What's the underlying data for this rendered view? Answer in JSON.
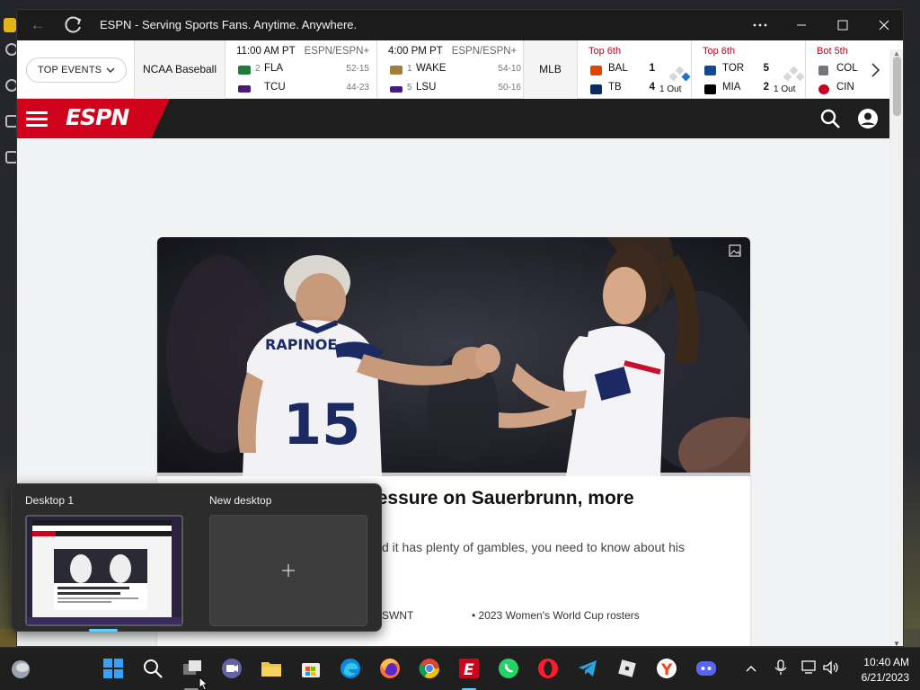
{
  "window": {
    "title": "ESPN - Serving Sports Fans. Anytime. Anywhere."
  },
  "scores_bar": {
    "top_events_label": "TOP EVENTS",
    "ncaa_label": "NCAA Baseball",
    "mlb_label": "MLB",
    "ncaa_games": [
      {
        "time": "11:00 AM PT",
        "network": "ESPN/ESPN+",
        "teams": [
          {
            "rank": "2",
            "abbr": "FLA",
            "record": "52-15"
          },
          {
            "rank": "",
            "abbr": "TCU",
            "record": "44-23"
          }
        ]
      },
      {
        "time": "4:00 PM PT",
        "network": "ESPN/ESPN+",
        "teams": [
          {
            "rank": "1",
            "abbr": "WAKE",
            "record": "54-10"
          },
          {
            "rank": "5",
            "abbr": "LSU",
            "record": "50-16"
          }
        ]
      }
    ],
    "mlb_games": [
      {
        "inning": "Top 6th",
        "teams": [
          {
            "abbr": "BAL",
            "score": "1"
          },
          {
            "abbr": "TB",
            "score": "4"
          }
        ],
        "outs": "1 Out"
      },
      {
        "inning": "Top 6th",
        "teams": [
          {
            "abbr": "TOR",
            "score": "5"
          },
          {
            "abbr": "MIA",
            "score": "2"
          }
        ],
        "outs": "1 Out"
      },
      {
        "inning": "Bot 5th",
        "teams": [
          {
            "abbr": "COL",
            "score": ""
          },
          {
            "abbr": "CIN",
            "score": ""
          }
        ],
        "outs": ""
      }
    ]
  },
  "header": {
    "logo_text": "ESPN",
    "accent_color": "#d0021b"
  },
  "story": {
    "title": "Cup roster reaction: Pressure on Sauerbrunn, more",
    "description": "s announced his World Cup roster, and it has plenty of gambles, you need to know about his selections.",
    "related_links": [
      "SWNT",
      "• 2023 Women's World Cup rosters"
    ]
  },
  "task_view": {
    "desktop1_label": "Desktop 1",
    "new_desktop_label": "New desktop"
  },
  "taskbar": {
    "time": "10:40 AM",
    "date": "6/21/2023",
    "icons": [
      "widgets-icon",
      "start-icon",
      "search-icon",
      "task-view-icon",
      "teams-chat-icon",
      "file-explorer-icon",
      "store-icon",
      "edge-icon",
      "firefox-icon",
      "chrome-icon",
      "espn-app-icon",
      "whatsapp-icon",
      "opera-icon",
      "telegram-icon",
      "roblox-icon",
      "yandex-icon",
      "discord-icon"
    ]
  }
}
